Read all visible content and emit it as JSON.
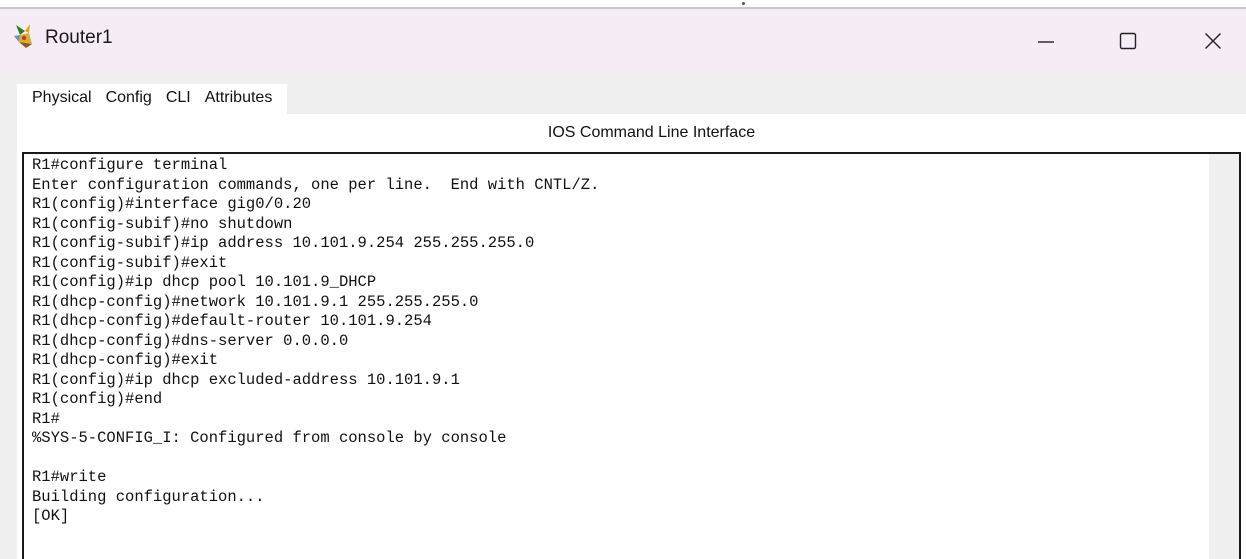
{
  "window": {
    "title": "Router1",
    "icon": "router-app-icon",
    "controls": {
      "minimize": "minimize-icon",
      "maximize": "maximize-icon",
      "close": "close-icon"
    }
  },
  "tabs": [
    {
      "label": "Physical",
      "active": false
    },
    {
      "label": "Config",
      "active": false
    },
    {
      "label": "CLI",
      "active": true
    },
    {
      "label": "Attributes",
      "active": false
    }
  ],
  "panel": {
    "title": "IOS Command Line Interface"
  },
  "terminal": {
    "lines": [
      "R1#configure terminal",
      "Enter configuration commands, one per line.  End with CNTL/Z.",
      "R1(config)#interface gig0/0.20",
      "R1(config-subif)#no shutdown",
      "R1(config-subif)#ip address 10.101.9.254 255.255.255.0",
      "R1(config-subif)#exit",
      "R1(config)#ip dhcp pool 10.101.9_DHCP",
      "R1(dhcp-config)#network 10.101.9.1 255.255.255.0",
      "R1(dhcp-config)#default-router 10.101.9.254",
      "R1(dhcp-config)#dns-server 0.0.0.0",
      "R1(dhcp-config)#exit",
      "R1(config)#ip dhcp excluded-address 10.101.9.1",
      "R1(config)#end",
      "R1#",
      "%SYS-5-CONFIG_I: Configured from console by console",
      "",
      "R1#write",
      "Building configuration...",
      "[OK]"
    ]
  },
  "colors": {
    "titlebar_bg": "#f5ecf6",
    "content_bg": "#f0f0f0",
    "active_tab_underline": "#1f4e9c"
  }
}
